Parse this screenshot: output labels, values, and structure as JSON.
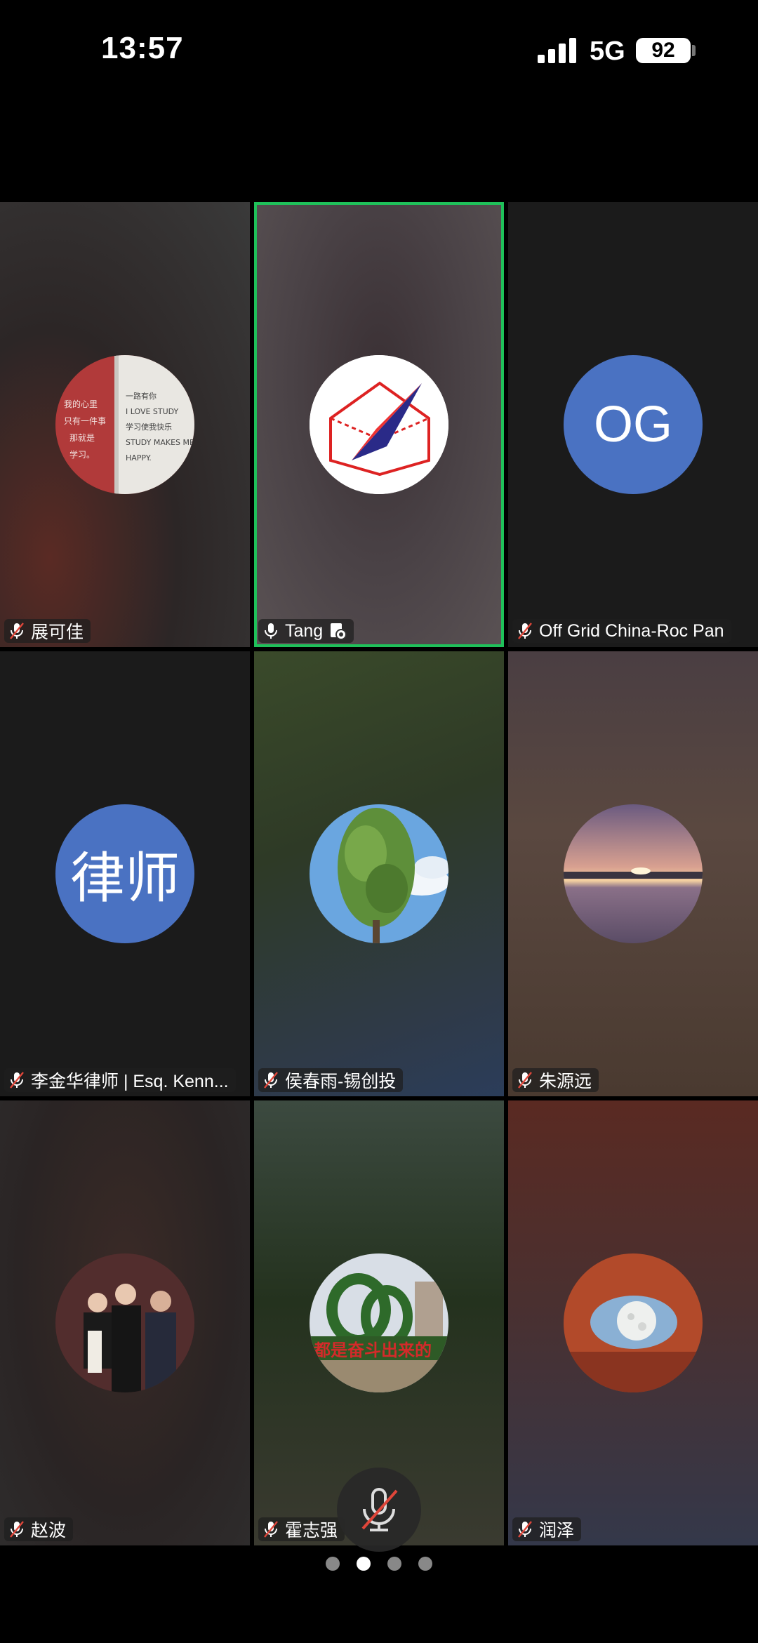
{
  "status": {
    "time": "13:57",
    "network": "5G",
    "battery": "92"
  },
  "participants": [
    {
      "name": "展可佳",
      "avatar": "study-note-photo",
      "muted": true
    },
    {
      "name": "Tang",
      "avatar": "paper-plane-logo",
      "muted": false,
      "host": true,
      "active": true,
      "active_color": "#1fc15a"
    },
    {
      "name": "Off Grid China-Roc Pan",
      "initials": "OG",
      "muted": true
    },
    {
      "name": "李金华律师 | Esq. Kenn...",
      "initials": "律师",
      "muted": true
    },
    {
      "name": "侯春雨-锡创投",
      "avatar": "tree-photo",
      "muted": true
    },
    {
      "name": "朱源远",
      "avatar": "sunset-sea-photo",
      "muted": true
    },
    {
      "name": "赵波",
      "avatar": "group-photo",
      "muted": true
    },
    {
      "name": "霍志强",
      "avatar": "topiary-sign-photo",
      "muted": true
    },
    {
      "name": "润泽",
      "avatar": "moon-arch-photo",
      "muted": true
    }
  ],
  "controls": {
    "mic_button": "mic-muted-icon"
  },
  "pager": {
    "pages": 4,
    "current": 2
  }
}
